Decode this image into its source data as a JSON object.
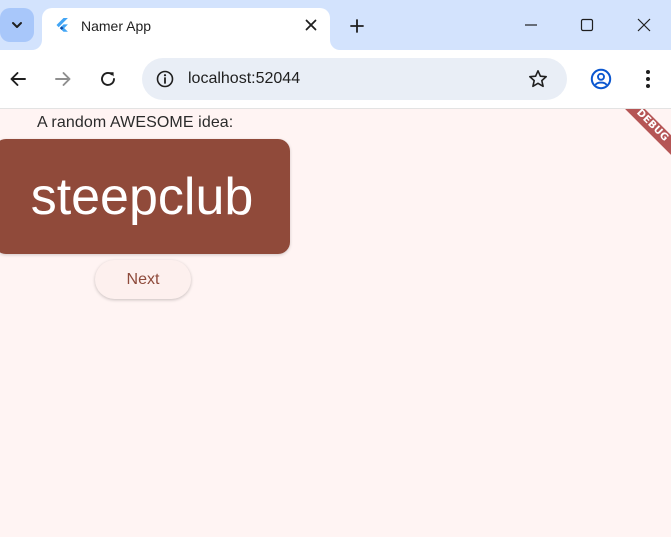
{
  "browser": {
    "tab": {
      "title": "Namer App",
      "favicon": "flutter-logo-icon"
    },
    "address_bar": {
      "url": "localhost:52044"
    },
    "icons": {
      "tab_search": "chevron-down-icon",
      "tab_close": "close-icon",
      "new_tab": "plus-icon",
      "minimize": "minimize-icon",
      "maximize": "maximize-icon",
      "window_close": "close-icon",
      "back": "arrow-left-icon",
      "forward": "arrow-right-icon",
      "reload": "reload-icon",
      "site_info": "info-icon",
      "bookmark": "star-icon",
      "profile": "profile-icon",
      "menu": "more-vert-icon"
    },
    "colors": {
      "tabstrip_bg": "#d3e3fd",
      "omnibox_bg": "#e9eef6"
    }
  },
  "app": {
    "caption": "A random AWESOME idea:",
    "word_pair": "steepclub",
    "next_button_label": "Next",
    "debug_banner": "DEBUG",
    "colors": {
      "background": "#fff4f3",
      "card": "#904a3a",
      "button_text": "#8e4a3b"
    }
  }
}
